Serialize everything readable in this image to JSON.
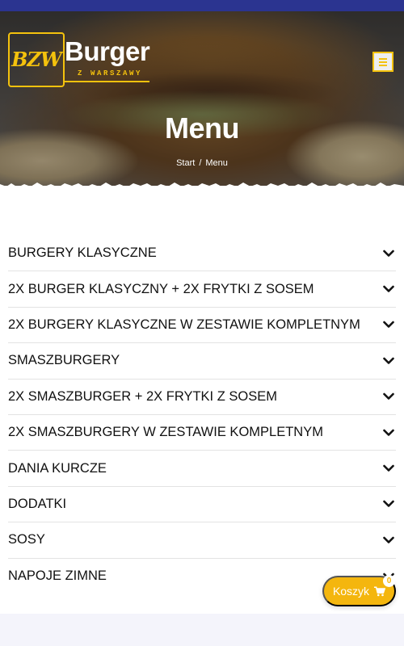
{
  "header": {
    "logo": {
      "badge": "BZW",
      "word": "Burger",
      "sub": "Z WARSZAWY"
    }
  },
  "hero": {
    "title": "Menu",
    "breadcrumb": {
      "home": "Start",
      "separator": "/",
      "current": "Menu"
    }
  },
  "menu": {
    "categories": [
      {
        "label": "BURGERY KLASYCZNE"
      },
      {
        "label": "2X BURGER KLASYCZNY + 2X FRYTKI Z SOSEM"
      },
      {
        "label": "2X BURGERY KLASYCZNE W ZESTAWIE KOMPLETNYM"
      },
      {
        "label": "SMASZBURGERY"
      },
      {
        "label": "2X SMASZBURGER + 2X FRYTKI Z SOSEM"
      },
      {
        "label": "2X SMASZBURGERY W ZESTAWIE KOMPLETNYM"
      },
      {
        "label": "DANIA KURCZE"
      },
      {
        "label": "DODATKI"
      },
      {
        "label": "SOSY"
      },
      {
        "label": "NAPOJE ZIMNE"
      }
    ]
  },
  "cart": {
    "label": "Koszyk",
    "count": "0",
    "icon": "cart-icon"
  },
  "colors": {
    "accent": "#f4b60e",
    "top_strip": "#2b3490"
  }
}
